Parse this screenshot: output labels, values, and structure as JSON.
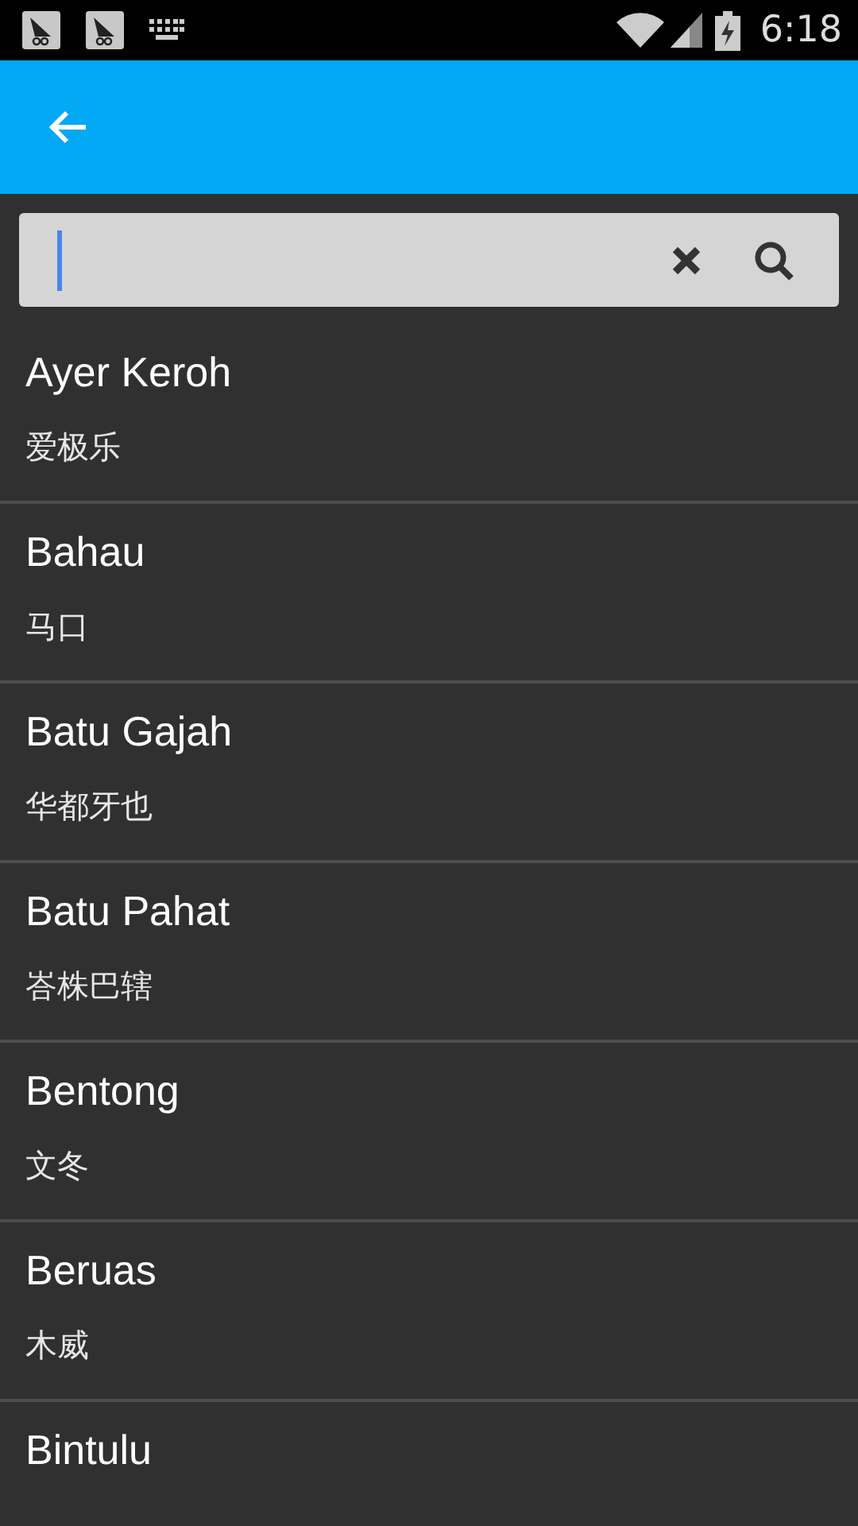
{
  "status_bar": {
    "time": "6:18"
  },
  "items": [
    {
      "title": "Ayer Keroh",
      "subtitle": "爱极乐"
    },
    {
      "title": "Bahau",
      "subtitle": "马口"
    },
    {
      "title": "Batu Gajah",
      "subtitle": "华都牙也"
    },
    {
      "title": "Batu Pahat",
      "subtitle": "峇株巴辖"
    },
    {
      "title": "Bentong",
      "subtitle": "文冬"
    },
    {
      "title": "Beruas",
      "subtitle": "木威"
    },
    {
      "title": "Bintulu"
    }
  ]
}
